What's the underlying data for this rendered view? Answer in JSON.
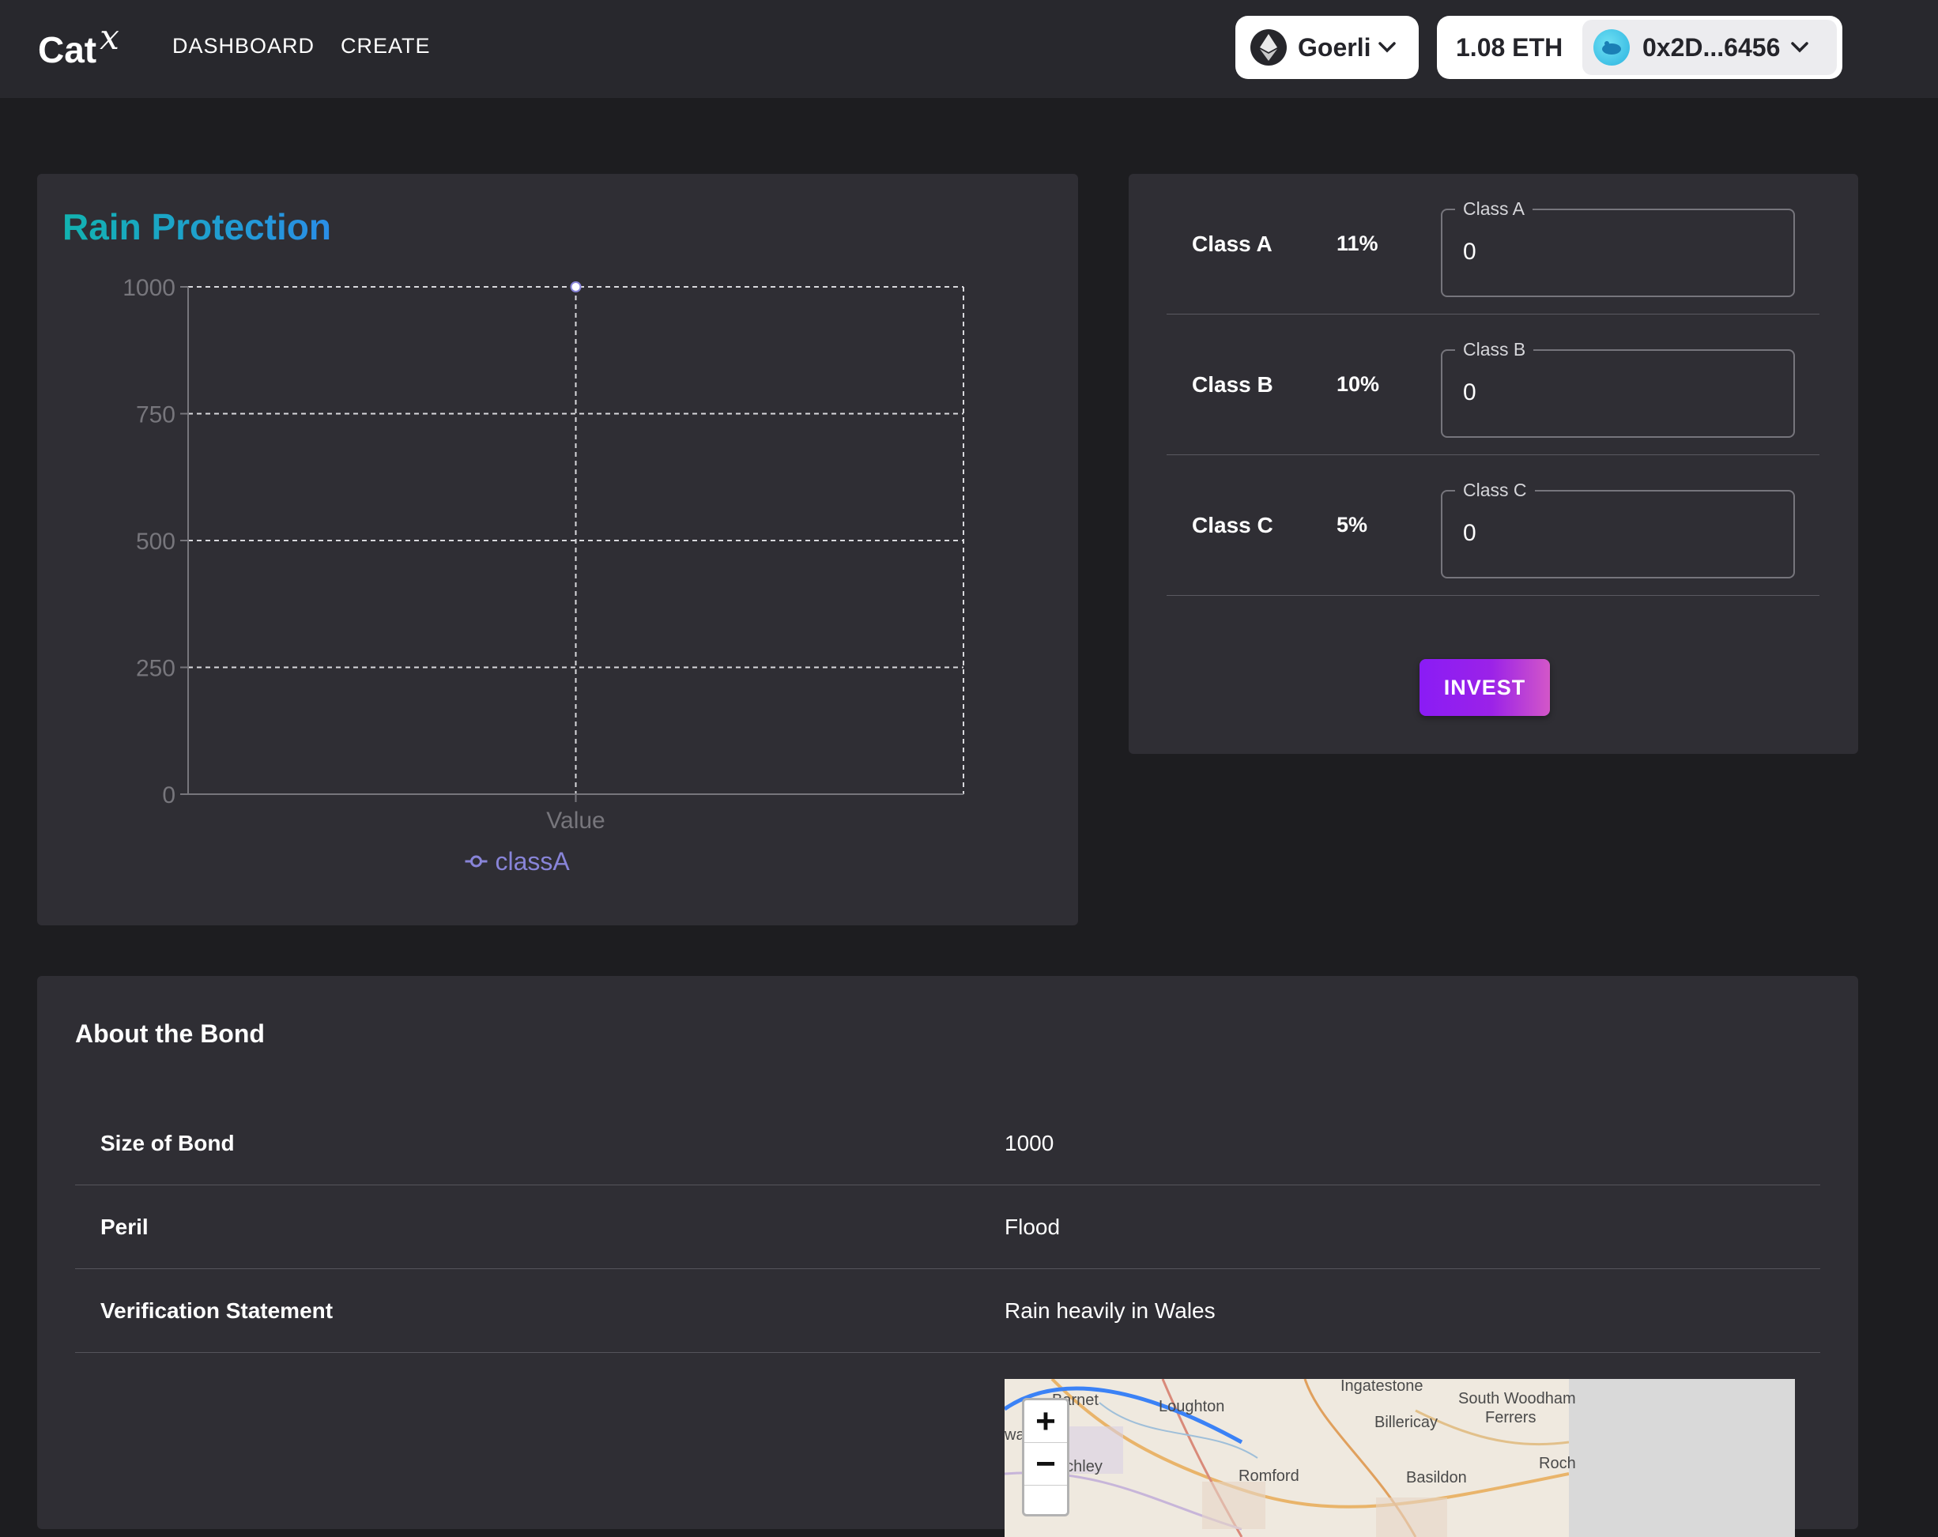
{
  "header": {
    "logo_text": "Cat",
    "logo_sup": "X",
    "nav": [
      {
        "label": "DASHBOARD"
      },
      {
        "label": "CREATE"
      }
    ],
    "network": {
      "label": "Goerli",
      "icon": "ethereum-icon"
    },
    "balance": "1.08 ETH",
    "account": {
      "address": "0x2D...6456",
      "icon": "avatar-icon"
    }
  },
  "chart_card": {
    "title": "Rain Protection"
  },
  "chart_data": {
    "type": "line",
    "title": "Rain Protection",
    "categories": [
      "Value"
    ],
    "series": [
      {
        "name": "classA",
        "values": [
          1000
        ],
        "color": "#8884d8"
      }
    ],
    "yticks": [
      "0",
      "250",
      "500",
      "750",
      "1000"
    ],
    "ylim": [
      0,
      1000
    ],
    "grid": true,
    "legend": "bottom"
  },
  "invest": {
    "rows": [
      {
        "name": "Class A",
        "pct": "11%",
        "field_label": "Class A",
        "value": "0"
      },
      {
        "name": "Class B",
        "pct": "10%",
        "field_label": "Class B",
        "value": "0"
      },
      {
        "name": "Class C",
        "pct": "5%",
        "field_label": "Class C",
        "value": "0"
      }
    ],
    "button_label": "INVEST"
  },
  "about": {
    "title": "About the Bond",
    "rows": [
      {
        "label": "Size of Bond",
        "value": "1000"
      },
      {
        "label": "Peril",
        "value": "Flood"
      },
      {
        "label": "Verification Statement",
        "value": "Rain heavily in Wales"
      }
    ],
    "map": {
      "zoom_in": "+",
      "zoom_out": "−",
      "places": [
        "Ingatestone",
        "South Woodham",
        "Ferrers",
        "Barnet",
        "Loughton",
        "Billericay",
        "nchley",
        "Romford",
        "Basildon",
        "Roch",
        "wa"
      ]
    }
  },
  "colors": {
    "background": "#1d1d20",
    "card": "#2f2e34",
    "header": "#28282d",
    "series": "#8884d8",
    "accent_button": "#8a1cf5"
  }
}
